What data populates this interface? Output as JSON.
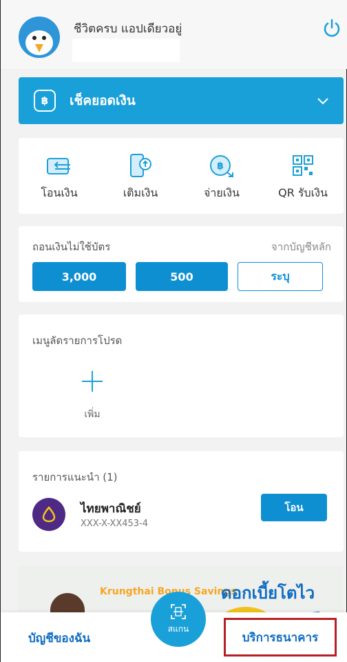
{
  "header": {
    "greeting": "ชีวิตครบ แอปเดียวอยู่"
  },
  "balance": {
    "label": "เช็คยอดเงิน",
    "currency_symbol": "฿"
  },
  "quick_actions": [
    {
      "label": "โอนเงิน",
      "icon": "transfer-icon"
    },
    {
      "label": "เติมเงิน",
      "icon": "topup-icon"
    },
    {
      "label": "จ่ายเงิน",
      "icon": "pay-icon"
    },
    {
      "label": "QR รับเงิน",
      "icon": "qr-icon"
    }
  ],
  "cardless": {
    "title": "ถอนเงินไม่ใช้บัตร",
    "source": "จากบัญชีหลัก",
    "amounts": [
      "3,000",
      "500"
    ],
    "custom": "ระบุ"
  },
  "favorites": {
    "title": "เมนูลัดรายการโปรด",
    "add_label": "เพิ่ม"
  },
  "suggested": {
    "title": "รายการแนะนำ (1)",
    "bank": "ไทยพาณิชย์",
    "account": "XXX-X-XX453-4",
    "button": "โอน"
  },
  "banner": {
    "subtitle": "Krungthai Bonus Savings",
    "title": "ดอกเบี้ยโตไว"
  },
  "nav": {
    "left": "บัญชีของฉัน",
    "scan": "สแกน",
    "right": "บริการธนาคาร"
  },
  "colors": {
    "primary": "#1aa0d8",
    "accent": "#0e6cc2",
    "highlight_border": "#b52025"
  }
}
